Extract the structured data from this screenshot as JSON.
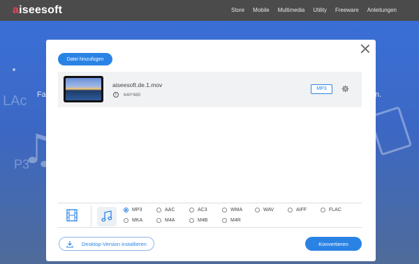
{
  "brand": {
    "logo_lead": "a",
    "logo_rest": "iseesoft"
  },
  "nav": {
    "items": [
      "Store",
      "Mobile",
      "Multimedia",
      "Utility",
      "Freeware",
      "Anleitungen"
    ]
  },
  "hero": {
    "text_left": "Fa",
    "text_right": "n."
  },
  "modal": {
    "add_button": "Datei hinzufügen",
    "file": {
      "name": "aiseesoft.de.1.mov",
      "resolution": "640*480",
      "format": "MP3"
    },
    "formats": [
      {
        "label": "MP3",
        "checked": true
      },
      {
        "label": "AAC",
        "checked": false
      },
      {
        "label": "AC3",
        "checked": false
      },
      {
        "label": "WMA",
        "checked": false
      },
      {
        "label": "WAV",
        "checked": false
      },
      {
        "label": "AIFF",
        "checked": false
      },
      {
        "label": "FLAC",
        "checked": false
      },
      {
        "label": "MKA",
        "checked": false
      },
      {
        "label": "M4A",
        "checked": false
      },
      {
        "label": "M4B",
        "checked": false
      },
      {
        "label": "M4R",
        "checked": false
      }
    ],
    "desktop_button": "Desktop-Version installieren",
    "convert_button": "Konvertieren"
  },
  "colors": {
    "accent": "#2a83e4",
    "brand_red": "#e8445a",
    "topbar": "#4b4b4b"
  },
  "icons": [
    "close-icon",
    "info-icon",
    "gear-icon",
    "film-icon",
    "music-note-icon",
    "download-icon"
  ]
}
